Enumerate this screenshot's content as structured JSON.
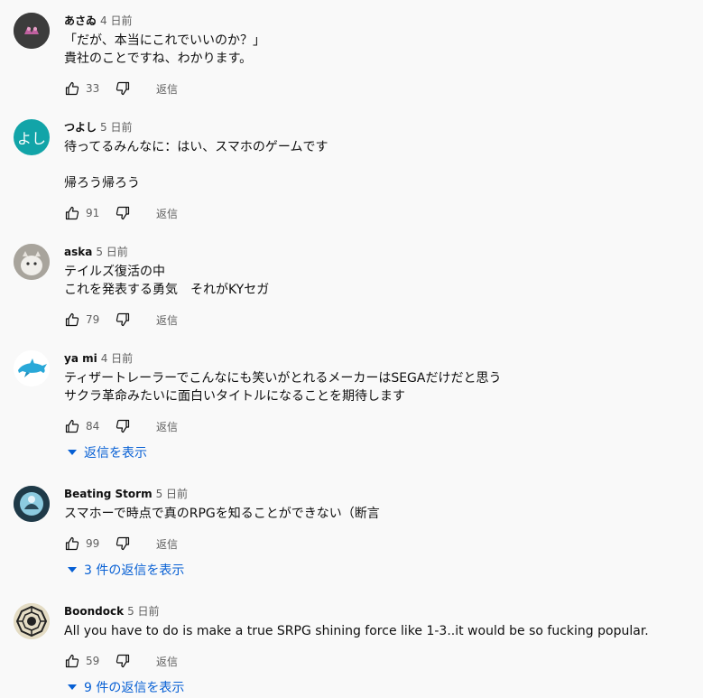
{
  "comments": [
    {
      "author": "あさゐ",
      "time": "4 日前",
      "text": "「だが、本当にこれでいいのか？」\n貴社のことですね、わかります。",
      "likes": "33",
      "reply_label": "返信",
      "avatar": {
        "type": "image",
        "bg": "#4a4a4a",
        "fg": "#c060a0"
      }
    },
    {
      "author": "つよし",
      "time": "5 日前",
      "text": "待ってるみんなに：はい、スマホのゲームです\n\n帰ろう帰ろう",
      "likes": "91",
      "reply_label": "返信",
      "avatar": {
        "type": "initials",
        "initials": "よし",
        "bg": "#12a4a8"
      }
    },
    {
      "author": "aska",
      "time": "5 日前",
      "text": "テイルズ復活の中\nこれを発表する勇気　それがKYセガ",
      "likes": "79",
      "reply_label": "返信",
      "avatar": {
        "type": "image",
        "bg": "#b8b4ae",
        "fg": "#f0eeea"
      }
    },
    {
      "author": "ya mi",
      "time": "4 日前",
      "text": "ティザートレーラーでこんなにも笑いがとれるメーカーはSEGAだけだと思う\nサクラ革命みたいに面白いタイトルになることを期待します",
      "likes": "84",
      "reply_label": "返信",
      "replies_label": "返信を表示",
      "avatar": {
        "type": "image",
        "bg": "#ffffff",
        "fg": "#29a8d8"
      }
    },
    {
      "author": "Beating Storm",
      "time": "5 日前",
      "text": "スマホーで時点で真のRPGを知ることができない（断言",
      "likes": "99",
      "reply_label": "返信",
      "replies_label": "3 件の返信を表示",
      "avatar": {
        "type": "image",
        "bg": "#2a4a5a",
        "fg": "#8ccbe0"
      }
    },
    {
      "author": "Boondock",
      "time": "5 日前",
      "text": "All you have to do is make a true SRPG shining force like 1-3..it would be so fucking popular.",
      "likes": "59",
      "reply_label": "返信",
      "replies_label": "9 件の返信を表示",
      "avatar": {
        "type": "image",
        "bg": "#d8d0b8",
        "fg": "#222222"
      }
    }
  ],
  "colors": {
    "background": "#f9f9f9",
    "link": "#065fd4",
    "secondary_text": "#606060"
  }
}
